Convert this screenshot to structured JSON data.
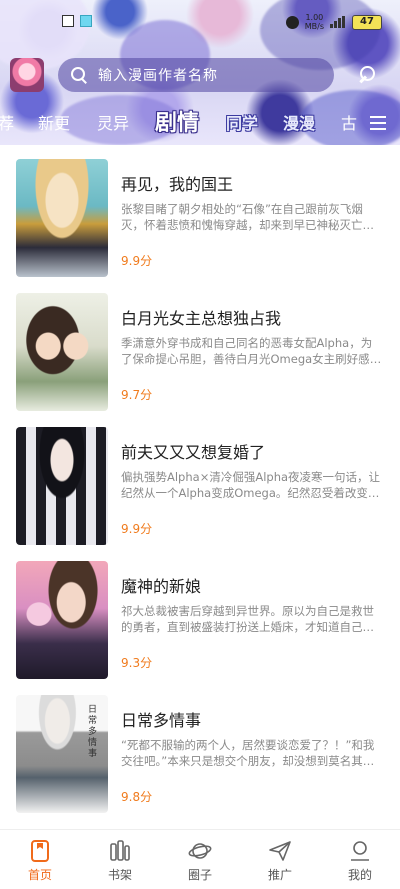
{
  "status_bar": {
    "net_speed_value": "1.00",
    "net_speed_unit": "MB/s",
    "battery": "47"
  },
  "search": {
    "placeholder": "输入漫画作者名称"
  },
  "tabs": [
    {
      "label": "荐"
    },
    {
      "label": "新更"
    },
    {
      "label": "灵异"
    },
    {
      "label": "剧情"
    },
    {
      "label": "同学"
    },
    {
      "label": "漫漫"
    },
    {
      "label": "古"
    }
  ],
  "comics": [
    {
      "title": "再见，我的国王",
      "desc": "张黎目睹了朝夕相处的“石像”在自己跟前灰飞烟灭，怀着悲愤和愧悔穿越，却来到早已神秘灭亡、传说…",
      "score": "9.9分"
    },
    {
      "title": "白月光女主总想独占我",
      "desc": "季潇意外穿书成和自己同名的恶毒女配Alpha，为了保命提心吊胆，善待白月光Omega女主刷好感度，…",
      "score": "9.7分"
    },
    {
      "title": "前夫又又又想复婚了",
      "desc": "偏执强势Alpha×清冷倔强Alpha夜凌寒一句话，让纪然从一个Alpha变成Omega。纪然忍受着改变体质…",
      "score": "9.9分"
    },
    {
      "title": "魔神的新娘",
      "desc": "祁大总裁被害后穿越到异世界。原以为自己是救世的勇者，直到被盛装打扮送上婚床，才知道自己成了…",
      "score": "9.3分"
    },
    {
      "title": "日常多情事",
      "desc": "“死都不服输的两个人，居然要谈恋爱了？！”和我交往吧。”本来只是想交个朋友，却没想到莫名其妙地提…",
      "score": "9.8分",
      "cover_text": "日常多情事"
    }
  ],
  "bottom_nav": [
    {
      "label": "首页",
      "icon": "home-icon",
      "active": true
    },
    {
      "label": "书架",
      "icon": "bookshelf-icon",
      "active": false
    },
    {
      "label": "圈子",
      "icon": "planet-icon",
      "active": false
    },
    {
      "label": "推广",
      "icon": "paper-plane-icon",
      "active": false
    },
    {
      "label": "我的",
      "icon": "user-icon",
      "active": false
    }
  ],
  "colors": {
    "accent": "#f06a1a",
    "score": "#f07b1d",
    "header_purple": "#5046a0"
  }
}
